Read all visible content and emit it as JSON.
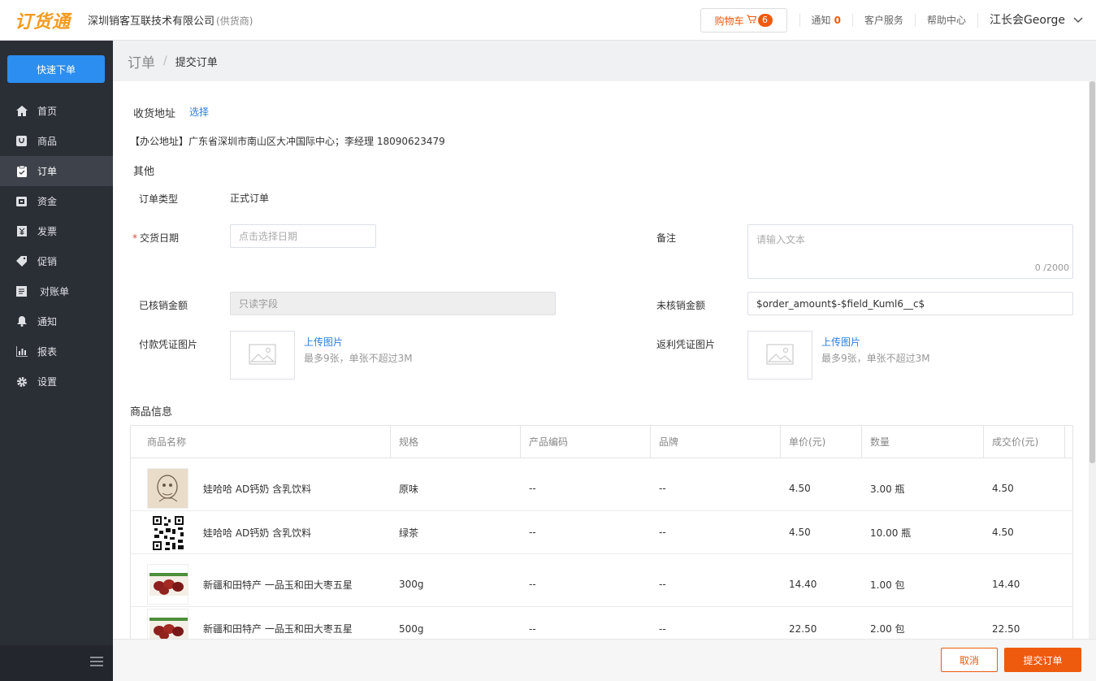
{
  "header": {
    "logo": "订货通",
    "company": "深圳销客互联技术有限公司",
    "company_tag": "(供货商)",
    "cart_label": "购物车",
    "cart_count": "6",
    "notify_label": "通知",
    "notify_count": "0",
    "service_label": "客户服务",
    "help_label": "帮助中心",
    "user_name": "江长会George"
  },
  "sidebar": {
    "quick_order": "快速下单",
    "items": [
      {
        "label": "首页",
        "icon": "home-icon"
      },
      {
        "label": "商品",
        "icon": "goods-icon"
      },
      {
        "label": "订单",
        "icon": "order-icon"
      },
      {
        "label": "资金",
        "icon": "funds-icon"
      },
      {
        "label": "发票",
        "icon": "invoice-icon"
      },
      {
        "label": "促销",
        "icon": "tag-icon"
      },
      {
        "label": "对账单",
        "icon": "statement-icon"
      },
      {
        "label": "通知",
        "icon": "bell-icon"
      },
      {
        "label": "报表",
        "icon": "chart-icon"
      },
      {
        "label": "设置",
        "icon": "gear-icon"
      }
    ]
  },
  "breadcrumb": {
    "root": "订单",
    "sep": "/",
    "current": "提交订单"
  },
  "form": {
    "address_label": "收货地址",
    "address_select": "选择",
    "address_text": "【办公地址】广东省深圳市南山区大冲国际中心；李经理 18090623479",
    "other_label": "其他",
    "order_type_label": "订单类型",
    "order_type_value": "正式订单",
    "delivery_date_label": "交货日期",
    "delivery_date_placeholder": "点击选择日期",
    "remark_label": "备注",
    "remark_placeholder": "请输入文本",
    "remark_counter": "0 /2000",
    "verified_label": "已核销金额",
    "verified_placeholder": "只读字段",
    "unverified_label": "未核销金额",
    "unverified_value": "$order_amount$-$field_Kuml6__c$",
    "payment_proof_label": "付款凭证图片",
    "rebate_proof_label": "返利凭证图片",
    "upload_link": "上传图片",
    "upload_hint": "最多9张，单张不超过3M"
  },
  "products": {
    "title": "商品信息",
    "columns": [
      "商品名称",
      "规格",
      "产品编码",
      "品牌",
      "单价(元)",
      "数量",
      "成交价(元)"
    ],
    "rows": [
      {
        "name": "娃哈哈 AD钙奶 含乳饮料",
        "spec": "原味",
        "code": "--",
        "brand": "--",
        "price": "4.50",
        "qty": "3.00 瓶",
        "deal": "4.50"
      },
      {
        "name": "娃哈哈 AD钙奶 含乳饮料",
        "spec": "绿茶",
        "code": "--",
        "brand": "--",
        "price": "4.50",
        "qty": "10.00 瓶",
        "deal": "4.50"
      },
      {
        "name": "新疆和田特产 一品玉和田大枣五星",
        "spec": "300g",
        "code": "--",
        "brand": "--",
        "price": "14.40",
        "qty": "1.00 包",
        "deal": "14.40"
      },
      {
        "name": "新疆和田特产 一品玉和田大枣五星",
        "spec": "500g",
        "code": "--",
        "brand": "--",
        "price": "22.50",
        "qty": "2.00 包",
        "deal": "22.50"
      }
    ]
  },
  "footer": {
    "cancel": "取消",
    "submit": "提交订单"
  }
}
